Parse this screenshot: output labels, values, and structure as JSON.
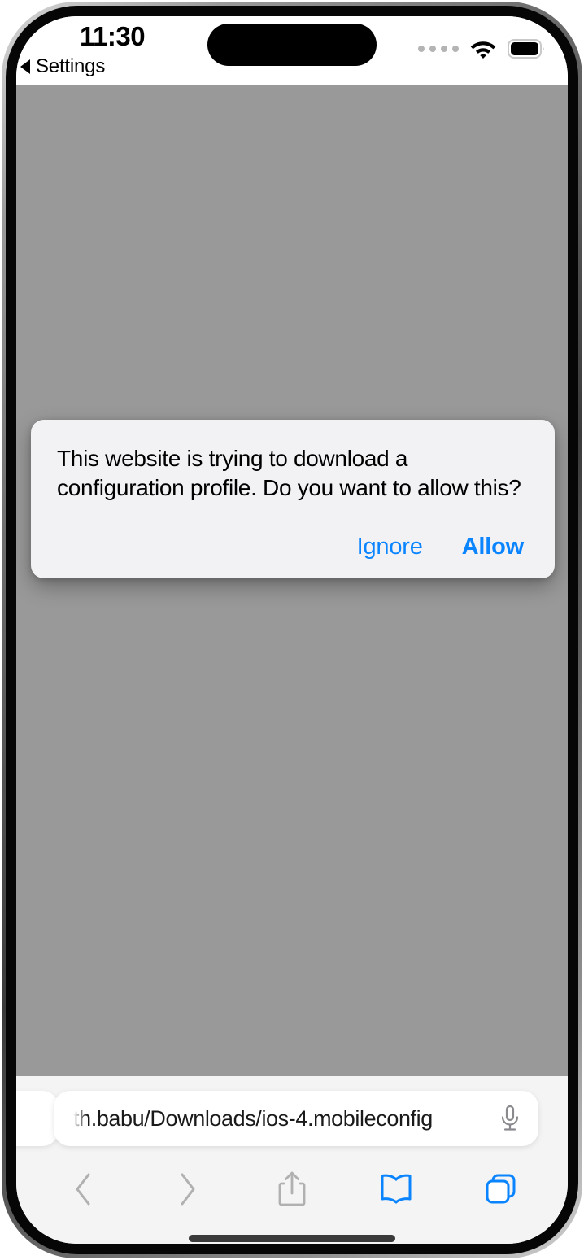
{
  "device": {
    "name": "iPhone with Dynamic Island",
    "bezel_color": "#060606",
    "screen_background": "#ffffff"
  },
  "status_bar": {
    "time": "11:30",
    "back_link_label": "Settings",
    "back_link_icon": "back-triangle-icon",
    "signal_dots_count": 4,
    "signal_dots_color": "#b4b4b4",
    "wifi_icon": "wifi-icon",
    "battery_icon": "battery-full-icon",
    "battery_level_percent": 100
  },
  "web_content": {
    "background_color": "#999999"
  },
  "dialog": {
    "message": "This website is trying to download a configuration profile. Do you want to allow this?",
    "background_color": "#f2f2f5",
    "accent_color": "#0a84ff",
    "buttons": [
      {
        "label": "Ignore",
        "emphasis": "regular"
      },
      {
        "label": "Allow",
        "emphasis": "bold"
      }
    ],
    "ignore_label": "Ignore",
    "allow_label": "Allow"
  },
  "browser": {
    "url_display": "th.babu/Downloads/ios-4.mobileconfig",
    "url_truncated_left": true,
    "microphone_icon": "microphone-icon",
    "toolbar": [
      {
        "name": "back",
        "icon": "chevron-left-icon",
        "state": "disabled",
        "color": "#b0b0b0"
      },
      {
        "name": "forward",
        "icon": "chevron-right-icon",
        "state": "disabled",
        "color": "#b0b0b0"
      },
      {
        "name": "share",
        "icon": "share-icon",
        "state": "disabled",
        "color": "#b0b0b0"
      },
      {
        "name": "bookmarks",
        "icon": "book-icon",
        "state": "enabled",
        "color": "#0a84ff"
      },
      {
        "name": "tabs",
        "icon": "tabs-icon",
        "state": "enabled",
        "color": "#0a84ff"
      }
    ],
    "toolbar_back_label": "Back",
    "toolbar_forward_label": "Forward",
    "toolbar_share_label": "Share",
    "toolbar_bookmarks_label": "Bookmarks",
    "toolbar_tabs_label": "Tabs"
  }
}
